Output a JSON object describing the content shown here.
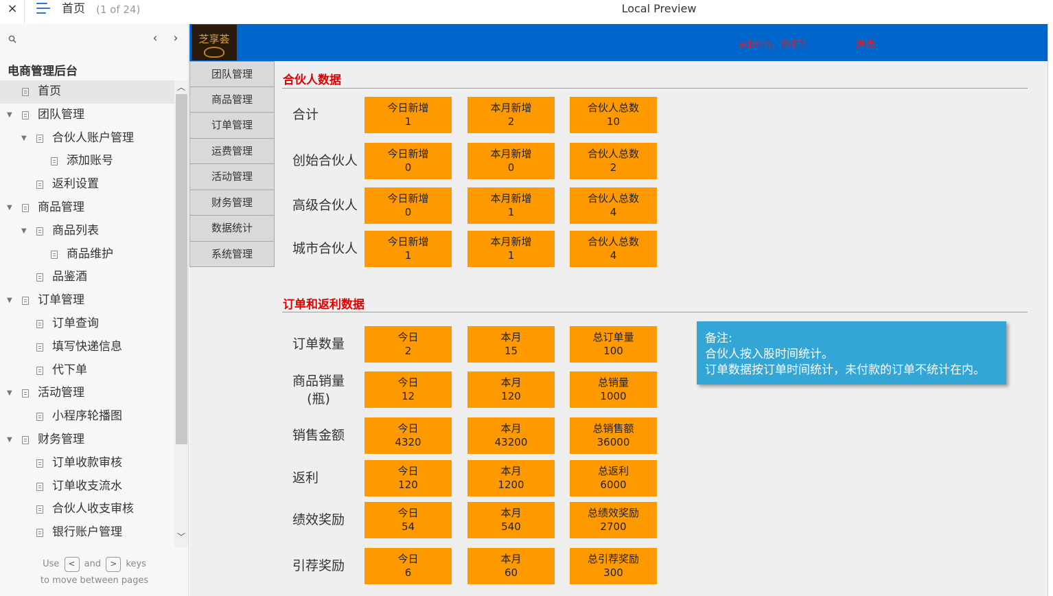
{
  "topbar": {
    "close": "×",
    "page_name": "首页",
    "page_count": "(1 of 24)",
    "window_title": "Local Preview"
  },
  "sidebar": {
    "site_title": "电商管理后台",
    "nav_prev": "‹",
    "nav_next": "›",
    "tree": [
      {
        "label": "首页",
        "level": 0,
        "expandable": false,
        "active": true
      },
      {
        "label": "团队管理",
        "level": 0,
        "expandable": true
      },
      {
        "label": "合伙人账户管理",
        "level": 1,
        "expandable": true
      },
      {
        "label": "添加账号",
        "level": 2,
        "expandable": false
      },
      {
        "label": "返利设置",
        "level": 1,
        "expandable": false
      },
      {
        "label": "商品管理",
        "level": 0,
        "expandable": true
      },
      {
        "label": "商品列表",
        "level": 1,
        "expandable": true
      },
      {
        "label": "商品维护",
        "level": 2,
        "expandable": false
      },
      {
        "label": "品鉴酒",
        "level": 1,
        "expandable": false
      },
      {
        "label": "订单管理",
        "level": 0,
        "expandable": true
      },
      {
        "label": "订单查询",
        "level": 1,
        "expandable": false
      },
      {
        "label": "填写快递信息",
        "level": 1,
        "expandable": false
      },
      {
        "label": "代下单",
        "level": 1,
        "expandable": false
      },
      {
        "label": "活动管理",
        "level": 0,
        "expandable": true
      },
      {
        "label": "小程序轮播图",
        "level": 1,
        "expandable": false
      },
      {
        "label": "财务管理",
        "level": 0,
        "expandable": true
      },
      {
        "label": "订单收款审核",
        "level": 1,
        "expandable": false
      },
      {
        "label": "订单收支流水",
        "level": 1,
        "expandable": false
      },
      {
        "label": "合伙人收支审核",
        "level": 1,
        "expandable": false
      },
      {
        "label": "银行账户管理",
        "level": 1,
        "expandable": false
      }
    ],
    "hint_use": "Use",
    "hint_and": "and",
    "hint_keys": "keys",
    "hint_line2": "to move between pages",
    "key_left": "<",
    "key_right": ">"
  },
  "preview": {
    "logo_text": "芝享荟",
    "user_greet": "admin，你好!",
    "logout": "退出",
    "menu": [
      "团队管理",
      "商品管理",
      "订单管理",
      "运费管理",
      "活动管理",
      "财务管理",
      "数据统计",
      "系统管理"
    ],
    "partner_section_title": "合伙人数据",
    "partner_rows": [
      {
        "label": "合计",
        "boxes": [
          {
            "title": "今日新增",
            "value": "1"
          },
          {
            "title": "本月新增",
            "value": "2"
          },
          {
            "title": "合伙人总数",
            "value": "10"
          }
        ]
      },
      {
        "label": "创始合伙人",
        "boxes": [
          {
            "title": "今日新增",
            "value": "0"
          },
          {
            "title": "本月新增",
            "value": "0"
          },
          {
            "title": "合伙人总数",
            "value": "2"
          }
        ]
      },
      {
        "label": "高级合伙人",
        "boxes": [
          {
            "title": "今日新增",
            "value": "0"
          },
          {
            "title": "本月新增",
            "value": "1"
          },
          {
            "title": "合伙人总数",
            "value": "4"
          }
        ]
      },
      {
        "label": "城市合伙人",
        "boxes": [
          {
            "title": "今日新增",
            "value": "1"
          },
          {
            "title": "本月新增",
            "value": "1"
          },
          {
            "title": "合伙人总数",
            "value": "4"
          }
        ]
      }
    ],
    "order_section_title": "订单和返利数据",
    "order_rows": [
      {
        "label": "订单数量",
        "label2": "",
        "boxes": [
          {
            "title": "今日",
            "value": "2"
          },
          {
            "title": "本月",
            "value": "15"
          },
          {
            "title": "总订单量",
            "value": "100"
          }
        ]
      },
      {
        "label": "商品销量",
        "label2": "(瓶)",
        "boxes": [
          {
            "title": "今日",
            "value": "12"
          },
          {
            "title": "本月",
            "value": "120"
          },
          {
            "title": "总销量",
            "value": "1000"
          }
        ]
      },
      {
        "label": "销售金额",
        "label2": "",
        "boxes": [
          {
            "title": "今日",
            "value": "4320"
          },
          {
            "title": "本月",
            "value": "43200"
          },
          {
            "title": "总销售额",
            "value": "36000"
          }
        ]
      },
      {
        "label": "返利",
        "label2": "",
        "boxes": [
          {
            "title": "今日",
            "value": "120"
          },
          {
            "title": "本月",
            "value": "1200"
          },
          {
            "title": "总返利",
            "value": "6000"
          }
        ]
      },
      {
        "label": "绩效奖励",
        "label2": "",
        "boxes": [
          {
            "title": "今日",
            "value": "54"
          },
          {
            "title": "本月",
            "value": "540"
          },
          {
            "title": "总绩效奖励",
            "value": "2700"
          }
        ]
      },
      {
        "label": "引荐奖励",
        "label2": "",
        "boxes": [
          {
            "title": "今日",
            "value": "6"
          },
          {
            "title": "本月",
            "value": "60"
          },
          {
            "title": "总引荐奖励",
            "value": "300"
          }
        ]
      }
    ],
    "note": {
      "line1": "备注:",
      "line2": "合伙人按入股时间统计。",
      "line3": "订单数据按订单时间统计，未付款的订单不统计在内。"
    }
  },
  "colors": {
    "header_blue": "#0066cc",
    "stat_orange": "#ff9900",
    "section_red": "#e00000",
    "note_blue": "#33a6d6"
  }
}
